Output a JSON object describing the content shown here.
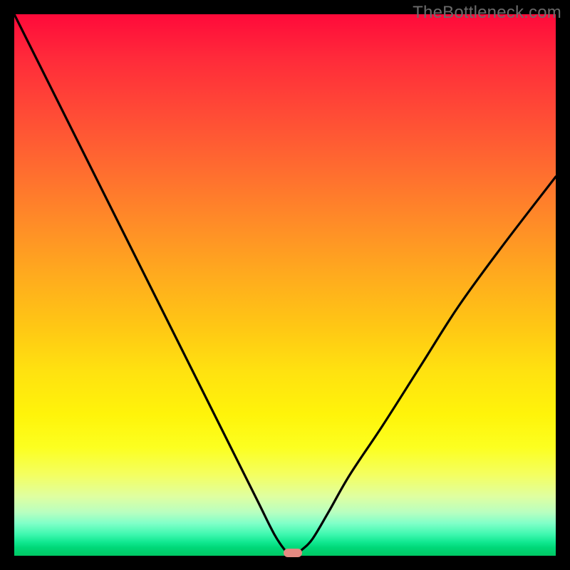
{
  "attribution": "TheBottleneck.com",
  "colors": {
    "frame": "#000000",
    "gradient_top": "#ff0a3a",
    "gradient_mid": "#ffe210",
    "gradient_bottom": "#00c864",
    "curve": "#000000",
    "marker": "#e48a82"
  },
  "chart_data": {
    "type": "line",
    "title": "",
    "xlabel": "",
    "ylabel": "",
    "xlim": [
      0,
      100
    ],
    "ylim": [
      0,
      100
    ],
    "grid": false,
    "legend": false,
    "series": [
      {
        "name": "bottleneck-curve",
        "x": [
          0,
          5,
          10,
          15,
          20,
          25,
          30,
          35,
          40,
          45,
          48,
          50,
          51,
          52,
          53,
          55,
          58,
          62,
          68,
          75,
          82,
          90,
          100
        ],
        "y": [
          100,
          90,
          80,
          70,
          60,
          50,
          40,
          30,
          20,
          10,
          4,
          1,
          0,
          0,
          1,
          3,
          8,
          15,
          24,
          35,
          46,
          57,
          70
        ]
      }
    ],
    "marker": {
      "x": 51.5,
      "y": 0.5
    },
    "note": "Axes are unlabeled in the source image; values are read off as percentages of plot width/height. y=0 is the green bottom, y=100 is the red top."
  }
}
